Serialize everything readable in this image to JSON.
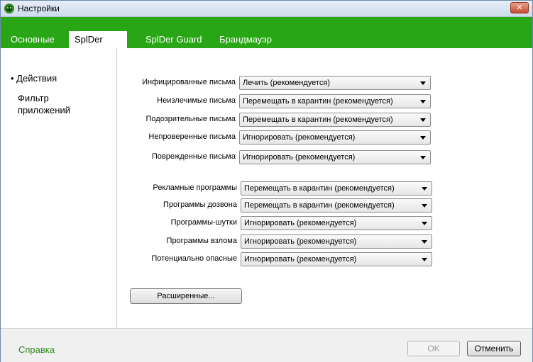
{
  "window": {
    "title": "Настройки"
  },
  "tabs": [
    "Основные",
    "SplDer Mail",
    "SplDer Guard",
    "Брандмауэр"
  ],
  "sidebar": {
    "items": [
      {
        "label": "• Действия"
      },
      {
        "label": "Фильтр\nприложений"
      }
    ]
  },
  "rows": [
    {
      "label": "Инфицированные письма",
      "value": "Лечить (рекомендуется)"
    },
    {
      "label": "Неизлечимые письма",
      "value": "Перемещать в карантин (рекомендуется)"
    },
    {
      "label": "Подозрительные письма",
      "value": "Перемещать в карантин (рекомендуется)"
    },
    {
      "label": "Непроверенные письма",
      "value": "Игнорировать (рекомендуется)"
    },
    {
      "label": "Поврежденные письма",
      "value": "Игнорировать (рекомендуется)"
    },
    {
      "label": "Рекламные программы",
      "value": "Перемещать в карантин (рекомендуется)"
    },
    {
      "label": "Программы дозвона",
      "value": "Перемещать в карантин (рекомендуется)"
    },
    {
      "label": "Программы-шутки",
      "value": "Игнорировать (рекомендуется)"
    },
    {
      "label": "Программы взлома",
      "value": "Игнорировать (рекомендуется)"
    },
    {
      "label": "Потенциально опасные",
      "value": "Игнорировать (рекомендуется)"
    }
  ],
  "advanced_button": "Расширенные...",
  "footer": {
    "help": "Справка",
    "ok": "OK",
    "cancel": "Отменить"
  },
  "colors": {
    "accent_green": "#28a615",
    "help_link": "#2f8a1a"
  }
}
